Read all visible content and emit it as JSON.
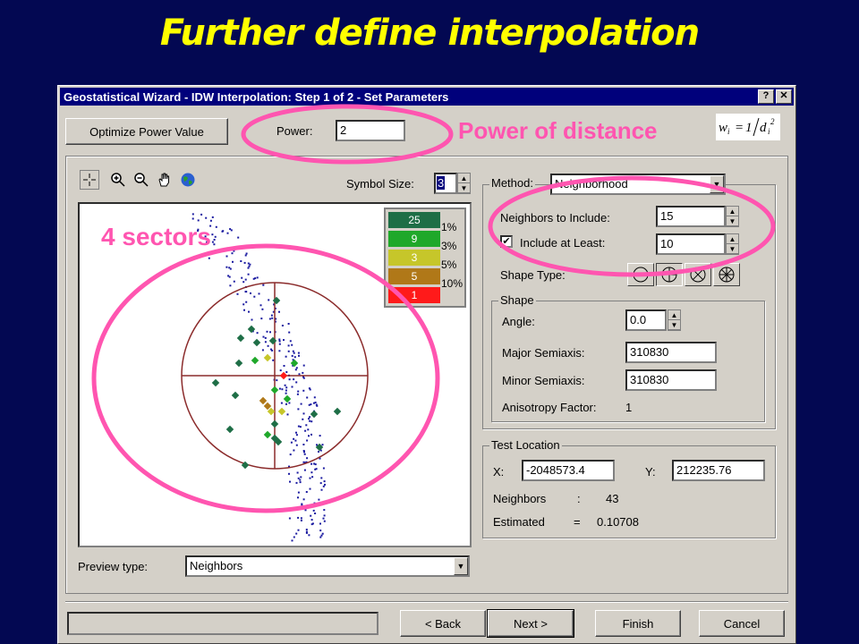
{
  "slide": {
    "title": "Further define interpolation"
  },
  "dialog": {
    "title": "Geostatistical Wizard - IDW Interpolation: Step 1 of 2 - Set Parameters",
    "help_btn": "?",
    "close_btn": "✕",
    "optimize_label": "Optimize Power Value",
    "power_label": "Power:",
    "power_value": "2",
    "symbol_size_label": "Symbol Size:",
    "symbol_size_value": "3",
    "method_label": "Method:",
    "method_value": "Neighborhood",
    "neighbors_label": "Neighbors to Include:",
    "neighbors_value": "15",
    "include_label": "Include at Least:",
    "include_value": "10",
    "include_checked": true,
    "shape_type_label": "Shape Type:",
    "shape_group": "Shape",
    "angle_label": "Angle:",
    "angle_value": "0.0",
    "major_label": "Major Semiaxis:",
    "major_value": "310830",
    "minor_label": "Minor Semiaxis:",
    "minor_value": "310830",
    "aniso_label": "Anisotropy Factor:",
    "aniso_value": "1",
    "test_group": "Test Location",
    "x_label": "X:",
    "x_value": "-2048573.4",
    "y_label": "Y:",
    "y_value": "212235.76",
    "neighbors_count_label": "Neighbors",
    "neighbors_count_sep": ":",
    "neighbors_count_value": "43",
    "estimated_label": "Estimated",
    "estimated_sep": "=",
    "estimated_value": "0.10708",
    "preview_type_label": "Preview type:",
    "preview_type_value": "Neighbors",
    "back_label": "< Back",
    "next_label": "Next >",
    "finish_label": "Finish",
    "cancel_label": "Cancel"
  },
  "legend": [
    {
      "value": "25",
      "pct": "1%",
      "color": "#1e6e46"
    },
    {
      "value": "9",
      "pct": "3%",
      "color": "#1fa82a"
    },
    {
      "value": "3",
      "pct": "5%",
      "color": "#c6c62a"
    },
    {
      "value": "5",
      "pct": "10%",
      "color": "#b07818"
    },
    {
      "value": "1",
      "pct": "",
      "color": "#ff1a1a"
    }
  ],
  "annotations": {
    "power": "Power of distance",
    "sectors": "4 sectors"
  },
  "colors": {
    "background": "#030852",
    "title": "#ffff00",
    "annotation": "#ff55b0",
    "titlebar": "#00007b"
  },
  "icons": [
    "crosshair-icon",
    "zoom-in-icon",
    "zoom-out-icon",
    "hand-pan-icon",
    "globe-icon"
  ]
}
